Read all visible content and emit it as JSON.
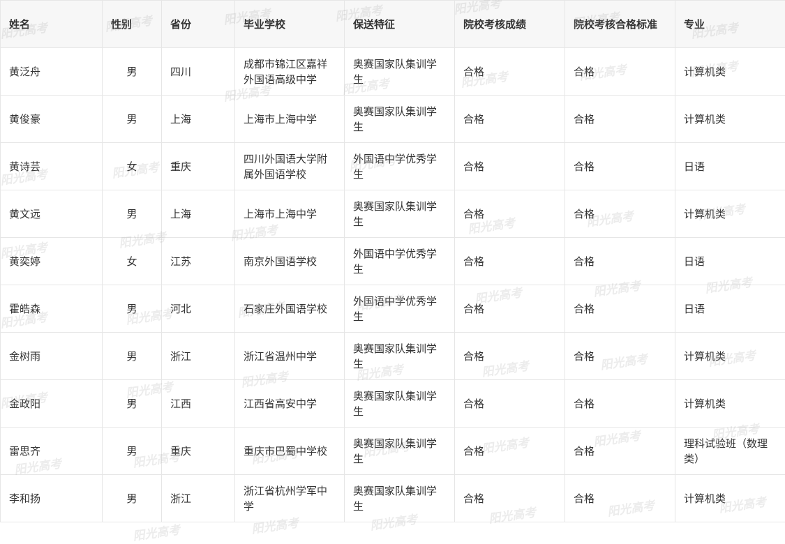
{
  "table": {
    "columns": [
      "姓名",
      "性别",
      "省份",
      "毕业学校",
      "保送特征",
      "院校考核成绩",
      "院校考核合格标准",
      "专业"
    ],
    "rows": [
      [
        "黄泛舟",
        "男",
        "四川",
        "成都市锦江区嘉祥外国语高级中学",
        "奥赛国家队集训学生",
        "合格",
        "合格",
        "计算机类"
      ],
      [
        "黄俊豪",
        "男",
        "上海",
        "上海市上海中学",
        "奥赛国家队集训学生",
        "合格",
        "合格",
        "计算机类"
      ],
      [
        "黄诗芸",
        "女",
        "重庆",
        "四川外国语大学附属外国语学校",
        "外国语中学优秀学生",
        "合格",
        "合格",
        "日语"
      ],
      [
        "黄文远",
        "男",
        "上海",
        "上海市上海中学",
        "奥赛国家队集训学生",
        "合格",
        "合格",
        "计算机类"
      ],
      [
        "黄奕婷",
        "女",
        "江苏",
        "南京外国语学校",
        "外国语中学优秀学生",
        "合格",
        "合格",
        "日语"
      ],
      [
        "霍皓森",
        "男",
        "河北",
        "石家庄外国语学校",
        "外国语中学优秀学生",
        "合格",
        "合格",
        "日语"
      ],
      [
        "金树雨",
        "男",
        "浙江",
        "浙江省温州中学",
        "奥赛国家队集训学生",
        "合格",
        "合格",
        "计算机类"
      ],
      [
        "金政阳",
        "男",
        "江西",
        "江西省高安中学",
        "奥赛国家队集训学生",
        "合格",
        "合格",
        "计算机类"
      ],
      [
        "雷思齐",
        "男",
        "重庆",
        "重庆市巴蜀中学校",
        "奥赛国家队集训学生",
        "合格",
        "合格",
        "理科试验班（数理类）"
      ],
      [
        "李和扬",
        "男",
        "浙江",
        "浙江省杭州学军中学",
        "奥赛国家队集训学生",
        "合格",
        "合格",
        "计算机类"
      ]
    ]
  },
  "watermark": {
    "text": "阳光高考",
    "color": "#aaaaaa"
  }
}
